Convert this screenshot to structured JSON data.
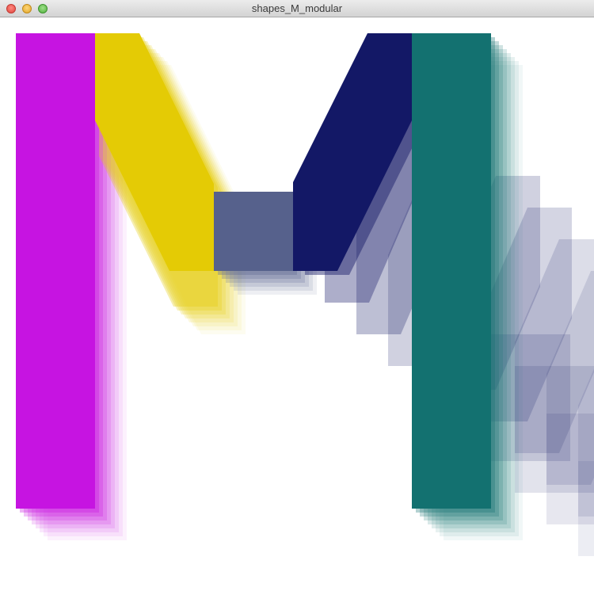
{
  "window": {
    "title": "shapes_M_modular"
  },
  "colors": {
    "magenta": "#c614e1",
    "yellow": "#e4cb05",
    "slate": "#56618c",
    "navy": "#131866",
    "teal": "#137170"
  },
  "icons": {
    "close": "close-icon",
    "minimize": "minimize-icon",
    "maximize": "maximize-icon"
  }
}
